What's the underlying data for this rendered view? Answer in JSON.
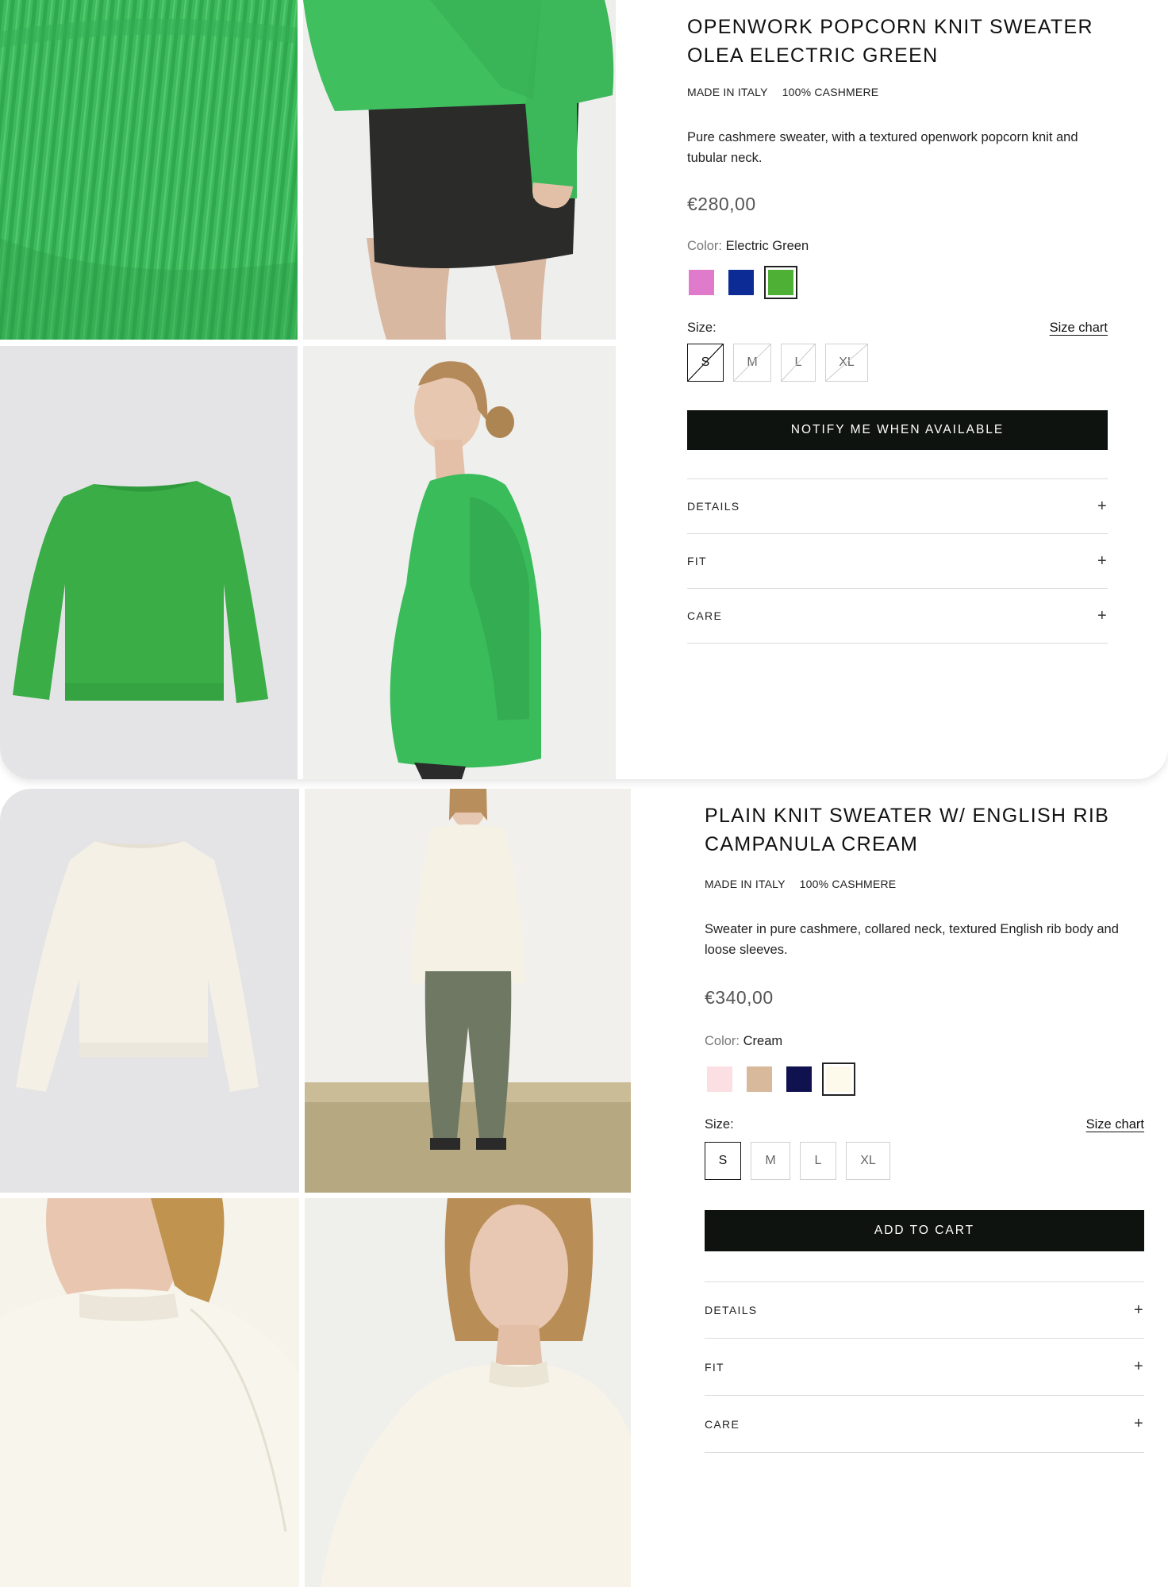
{
  "products": [
    {
      "title": "OPENWORK POPCORN KNIT SWEATER OLEA ELECTRIC GREEN",
      "tags": [
        "MADE IN ITALY",
        "100% CASHMERE"
      ],
      "description": "Pure cashmere sweater, with a textured openwork popcorn knit and tubular neck.",
      "price": "€280,00",
      "color_label": "Color:",
      "color_value": "Electric Green",
      "swatches": [
        {
          "name": "pink",
          "hex": "#e07bcb",
          "selected": false
        },
        {
          "name": "blue",
          "hex": "#0d2b95",
          "selected": false
        },
        {
          "name": "green",
          "hex": "#4eb135",
          "selected": true
        }
      ],
      "size_label": "Size:",
      "size_chart": "Size chart",
      "sizes": [
        {
          "label": "S",
          "selected": true,
          "available": false
        },
        {
          "label": "M",
          "selected": false,
          "available": false
        },
        {
          "label": "L",
          "selected": false,
          "available": false
        },
        {
          "label": "XL",
          "selected": false,
          "available": false
        }
      ],
      "cta": "NOTIFY ME WHEN AVAILABLE",
      "accordion": [
        "DETAILS",
        "FIT",
        "CARE"
      ]
    },
    {
      "title": "PLAIN KNIT SWEATER W/ ENGLISH RIB CAMPANULA CREAM",
      "tags": [
        "MADE IN ITALY",
        "100% CASHMERE"
      ],
      "description": "Sweater in pure cashmere, collared neck, textured English rib body and loose sleeves.",
      "price": "€340,00",
      "color_label": "Color:",
      "color_value": "Cream",
      "swatches": [
        {
          "name": "light-pink",
          "hex": "#fbdfe2",
          "selected": false
        },
        {
          "name": "beige",
          "hex": "#d8b99b",
          "selected": false
        },
        {
          "name": "navy",
          "hex": "#10114f",
          "selected": false
        },
        {
          "name": "cream",
          "hex": "#fdfaec",
          "selected": true
        }
      ],
      "size_label": "Size:",
      "size_chart": "Size chart",
      "sizes": [
        {
          "label": "S",
          "selected": true,
          "available": true
        },
        {
          "label": "M",
          "selected": false,
          "available": true
        },
        {
          "label": "L",
          "selected": false,
          "available": true
        },
        {
          "label": "XL",
          "selected": false,
          "available": true
        }
      ],
      "cta": "ADD TO CART",
      "accordion": [
        "DETAILS",
        "FIT",
        "CARE"
      ]
    }
  ]
}
